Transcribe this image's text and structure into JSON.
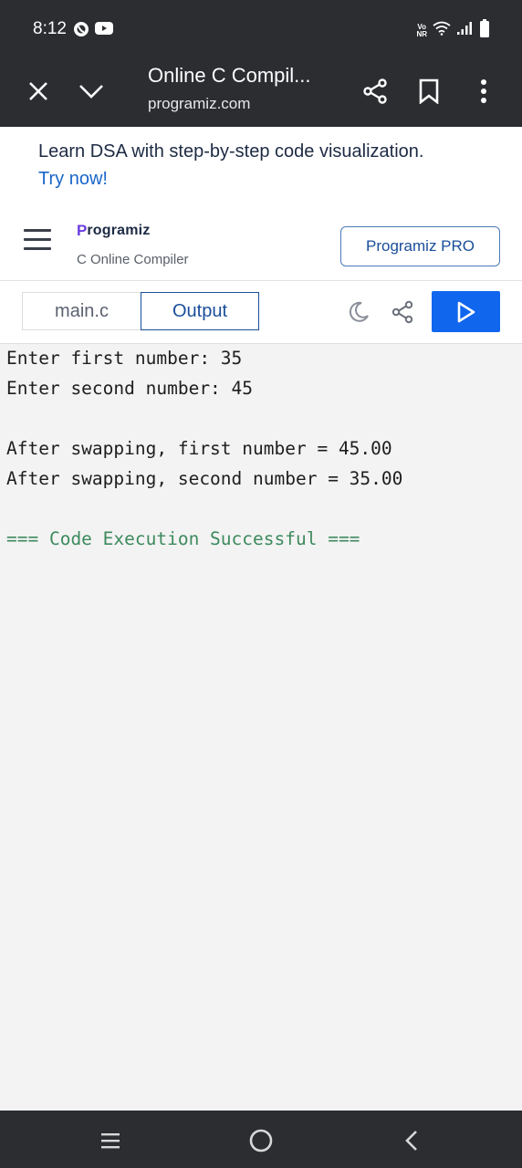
{
  "status_bar": {
    "time": "8:12",
    "left_icons": [
      "whatsapp-icon",
      "youtube-icon"
    ],
    "right_icons": [
      "volte-icon",
      "wifi-icon",
      "signal-icon",
      "battery-icon"
    ],
    "volte_top": "Vo",
    "volte_bottom": "NR"
  },
  "browser": {
    "title": "Online C Compil...",
    "url": "programiz.com"
  },
  "promo": {
    "text": "Learn DSA with step-by-step code visualization.",
    "link": "Try now!"
  },
  "header": {
    "logo_text": "rogramiz",
    "logo_initial": "P",
    "subtitle": "C Online Compiler",
    "pro_button": "Programiz PRO"
  },
  "toolbar": {
    "tab_file": "main.c",
    "tab_output": "Output"
  },
  "output": {
    "lines": [
      "Enter first number: 35",
      "Enter second number: 45",
      "",
      "After swapping, first number = 45.00",
      "After swapping, second number = 35.00",
      "",
      "=== Code Execution Successful ==="
    ]
  },
  "colors": {
    "accent": "#1166ee",
    "success": "#3d8a5e",
    "system_bar": "#2b2d31"
  }
}
